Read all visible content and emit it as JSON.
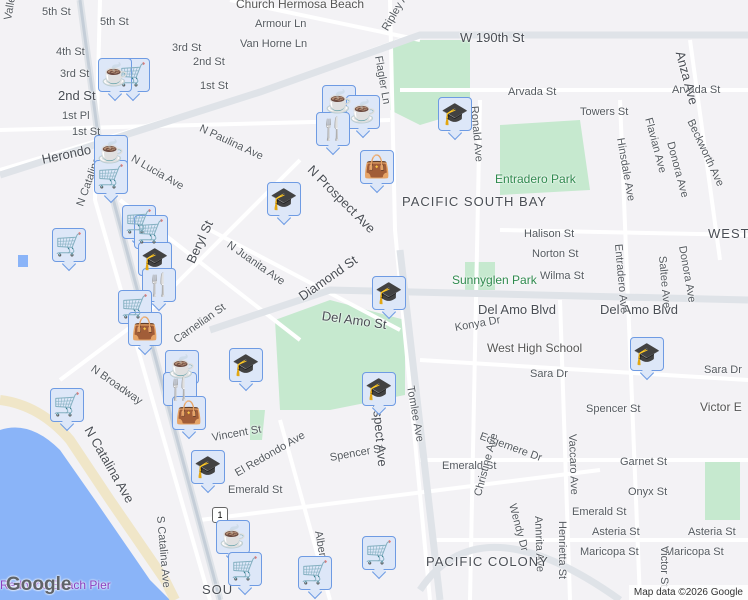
{
  "streets": [
    "5th St",
    "4th St",
    "3rd St",
    "2nd St",
    "1st St",
    "1st Pl",
    "1st St",
    "Armour Ln",
    "Van Horne Ln",
    "3rd St",
    "2nd St",
    "Ripley Ave",
    "W 190th St",
    "Flagler Ln",
    "Arvada St",
    "Arvada St",
    "Towers St",
    "Herondo St",
    "N Paulina Ave",
    "N Lucia Ave",
    "N Prospect Ave",
    "N Catalina Ave",
    "Beryl St",
    "N Juanita Ave",
    "Diamond St",
    "Del Amo St",
    "Carnelian St",
    "N Broadway",
    "N Catalina Ave",
    "Vincent St",
    "El Redondo Ave",
    "Spencer St",
    "Emerald St",
    "S Catalina Ave",
    "N Prospect Ave",
    "Tomlee Ave",
    "Konya Dr",
    "Del Amo Blvd",
    "Del Amo Blvd",
    "Sara Dr",
    "Sara Dr",
    "Spencer St",
    "Edgemere Dr",
    "Garnet St",
    "Emerald St",
    "Onyx St",
    "Emerald St",
    "Asteria St",
    "Asteria St",
    "Maricopa St",
    "Maricopa St",
    "Christine Ave",
    "Wendy Dr",
    "Annrita Ave",
    "Henrietta St",
    "Vaccaro Ave",
    "Halison St",
    "Norton St",
    "Wilma St",
    "Entradero Ave",
    "Saltee Ave",
    "Donora Ave",
    "Ronald Ave",
    "Flavian Ave",
    "Donora Ave",
    "Beckworth Ave",
    "Hinsdale Ave",
    "Anza Ave",
    "Valley Dr",
    "Alberta Ave",
    "Victor St"
  ],
  "areas": [
    "PACIFIC SOUTH BAY",
    "PACIFIC COLONY",
    "WEST",
    "SOU"
  ],
  "parks": [
    "Entradero Park",
    "Sunnyglen Park"
  ],
  "pois": [
    "Church Hermosa Beach",
    "West High School",
    "Victor E",
    "Redondo Beach Pier",
    "Diamond"
  ],
  "highway_shield": "1",
  "markers": [
    "cart",
    "coffee",
    "coffee",
    "coffee",
    "fork",
    "bag",
    "school",
    "coffee",
    "cart",
    "school",
    "cart",
    "cart",
    "cart",
    "school",
    "fork",
    "cart",
    "bag",
    "school",
    "coffee",
    "fork",
    "school",
    "bag",
    "cart",
    "school",
    "school",
    "school",
    "coffee",
    "cart",
    "cart",
    "cart"
  ],
  "icons": {
    "cart": "🛒",
    "coffee": "☕",
    "fork": "🍴",
    "bag": "👜",
    "school": "🎓"
  },
  "logo": "Google",
  "attribution": "Map data ©2026 Google"
}
